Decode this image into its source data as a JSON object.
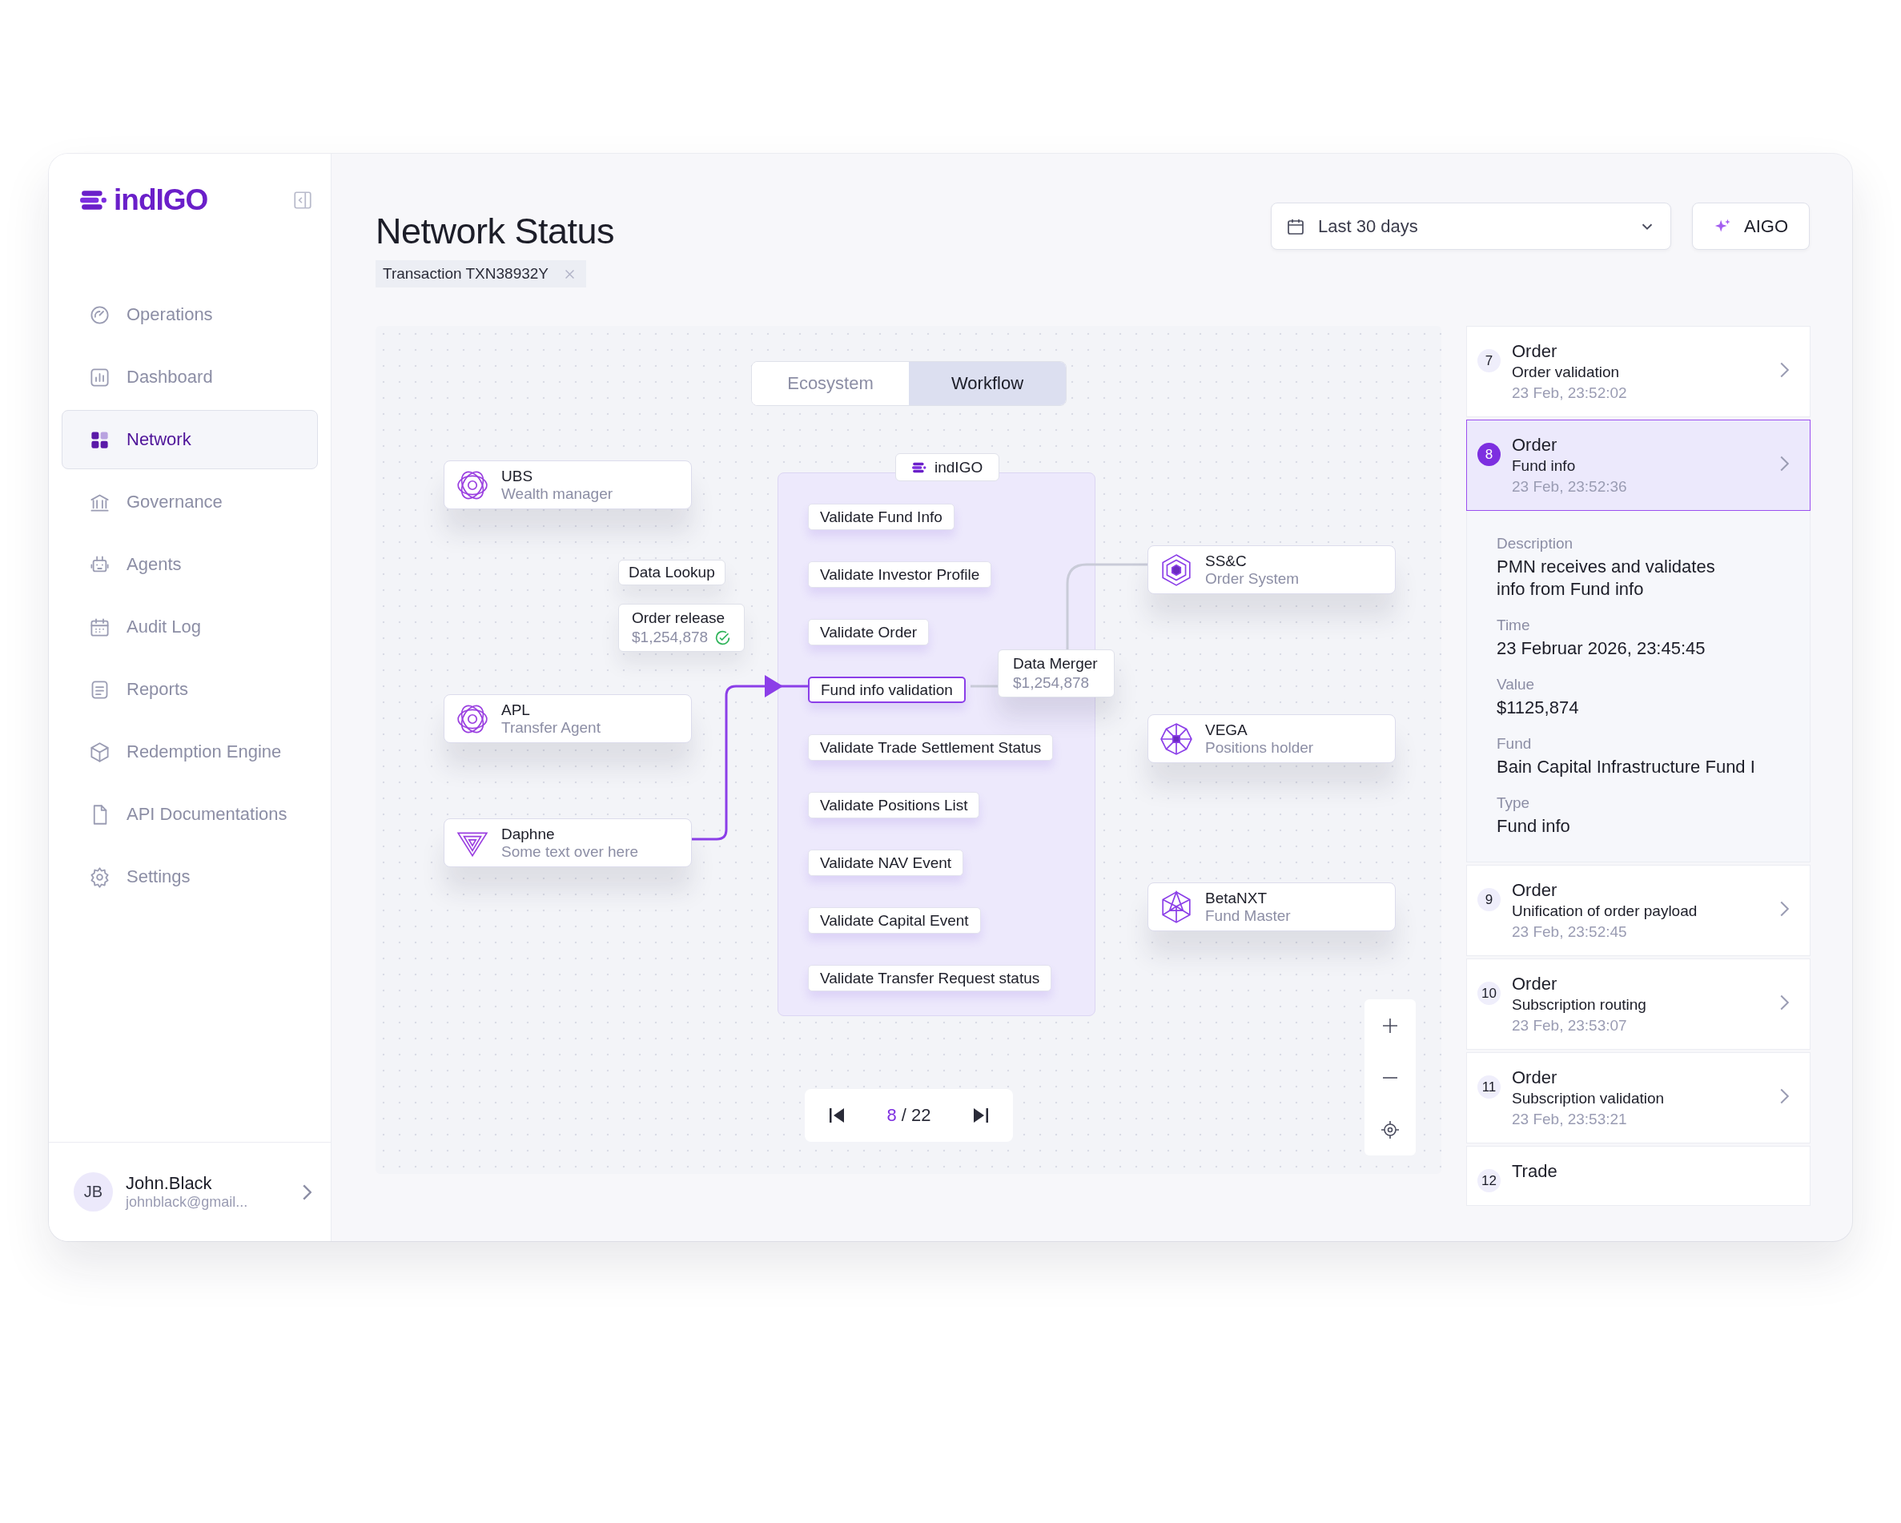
{
  "sidebar": {
    "logo": "indIGO",
    "nav": [
      {
        "label": "Operations",
        "selected": false
      },
      {
        "label": "Dashboard",
        "selected": false
      },
      {
        "label": "Network",
        "selected": true
      },
      {
        "label": "Governance",
        "selected": false
      },
      {
        "label": "Agents",
        "selected": false
      },
      {
        "label": "Audit Log",
        "selected": false
      },
      {
        "label": "Reports",
        "selected": false
      },
      {
        "label": "Redemption Engine",
        "selected": false
      },
      {
        "label": "API Documentations",
        "selected": false
      },
      {
        "label": "Settings",
        "selected": false
      }
    ],
    "user": {
      "initials": "JB",
      "name": "John.Black",
      "email": "johnblack@gmail..."
    }
  },
  "header": {
    "title": "Network Status",
    "filter_chip": "Transaction TXN38932Y",
    "date_range": "Last 30 days",
    "ai_button": "AIGO"
  },
  "canvas": {
    "view_toggle": [
      {
        "label": "Ecosystem",
        "selected": false
      },
      {
        "label": "Workflow",
        "selected": true
      }
    ],
    "left_nodes": [
      {
        "name": "UBS",
        "role": "Wealth manager"
      },
      {
        "name": "APL",
        "role": "Transfer Agent"
      },
      {
        "name": "Daphne",
        "role": "Some text over here"
      }
    ],
    "tags": [
      {
        "kind": "tag",
        "title": "Data Lookup"
      },
      {
        "kind": "amount",
        "title": "Order release",
        "amount": "$1,254,878",
        "verified": true
      }
    ],
    "pipeline": {
      "title": "indIGO",
      "steps": [
        {
          "label": "Validate Fund Info",
          "active": false
        },
        {
          "label": "Validate Investor Profile",
          "active": false
        },
        {
          "label": "Validate Order",
          "active": false
        },
        {
          "label": "Fund info validation",
          "active": true
        },
        {
          "label": "Validate Trade Settlement Status",
          "active": false
        },
        {
          "label": "Validate Positions List",
          "active": false
        },
        {
          "label": "Validate NAV Event",
          "active": false
        },
        {
          "label": "Validate Capital Event",
          "active": false
        },
        {
          "label": "Validate Transfer Request status",
          "active": false
        }
      ]
    },
    "merger": {
      "title": "Data Merger",
      "amount": "$1,254,878"
    },
    "right_nodes": [
      {
        "name": "SS&C",
        "role": "Order System"
      },
      {
        "name": "VEGA",
        "role": "Positions holder"
      },
      {
        "name": "BetaNXT",
        "role": "Fund Master"
      }
    ],
    "pager": {
      "current": "8",
      "total": "/ 22"
    }
  },
  "timeline": {
    "items": [
      {
        "number": "7",
        "title": "Order",
        "subtitle": "Order validation",
        "time": "23 Feb, 23:52:02",
        "selected": false
      },
      {
        "number": "8",
        "title": "Order",
        "subtitle": "Fund info",
        "time": "23 Feb, 23:52:36",
        "selected": true,
        "details": [
          {
            "label": "Description",
            "value": "PMN receives and validates info from Fund info"
          },
          {
            "label": "Time",
            "value": "23 Februar 2026, 23:45:45"
          },
          {
            "label": "Value",
            "value": "$1125,874"
          },
          {
            "label": "Fund",
            "value": "Bain Capital Infrastructure Fund I"
          },
          {
            "label": "Type",
            "value": "Fund info"
          }
        ]
      },
      {
        "number": "9",
        "title": "Order",
        "subtitle": "Unification of order payload",
        "time": "23 Feb, 23:52:45",
        "selected": false
      },
      {
        "number": "10",
        "title": "Order",
        "subtitle": "Subscription routing",
        "time": "23 Feb, 23:53:07",
        "selected": false
      },
      {
        "number": "11",
        "title": "Order",
        "subtitle": "Subscription validation",
        "time": "23 Feb, 23:53:21",
        "selected": false
      },
      {
        "number": "12",
        "title": "Trade",
        "selected": false
      }
    ]
  }
}
